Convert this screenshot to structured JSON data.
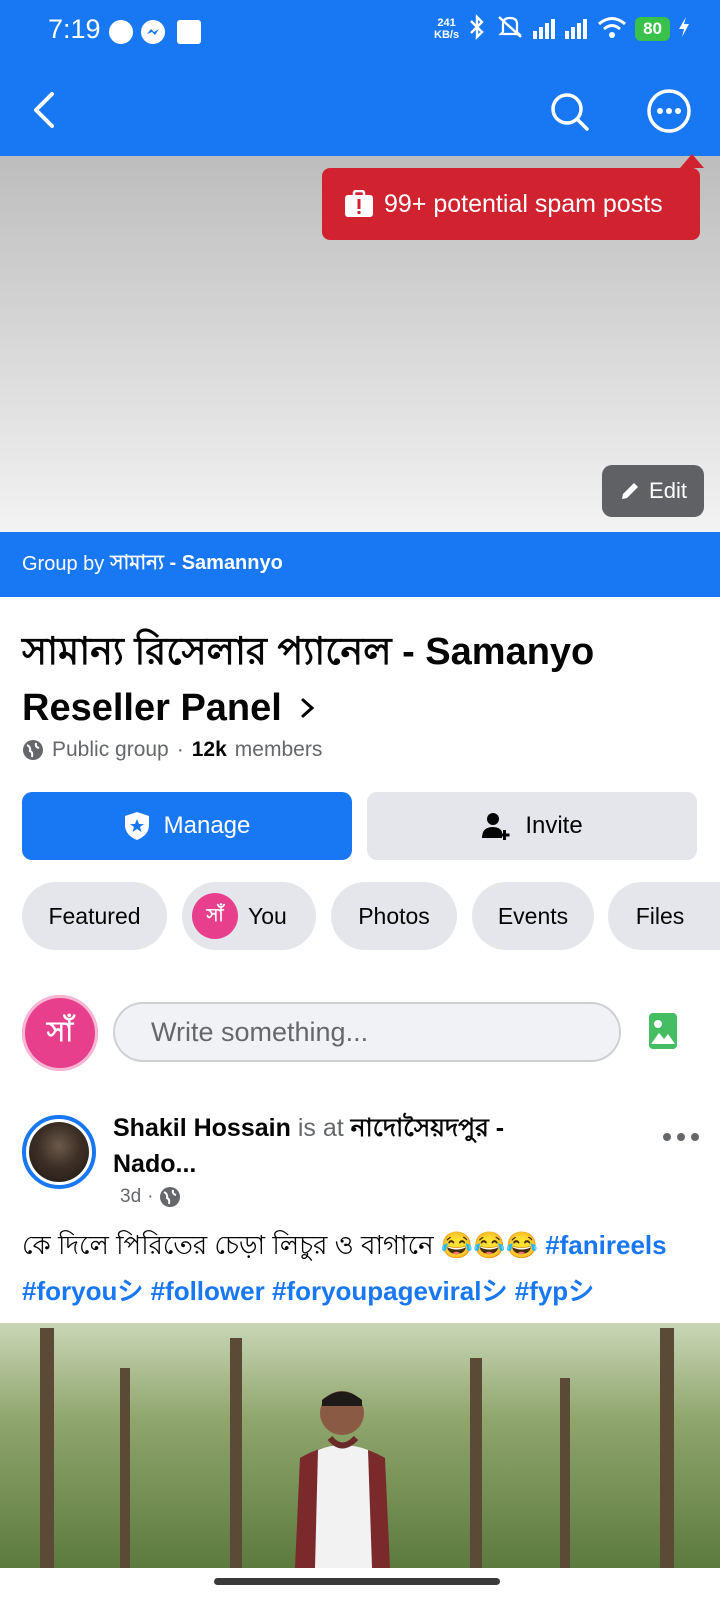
{
  "status_bar": {
    "time": "7:19",
    "net_speed_value": "241",
    "net_speed_unit": "KB/s",
    "battery": "80"
  },
  "colors": {
    "brand": "#1877f2",
    "spam": "#d0232f",
    "chip": "#e4e6eb"
  },
  "icons": [
    "back-arrow-icon",
    "search-icon",
    "more-icon",
    "spam-alert-icon",
    "pencil-icon",
    "globe-icon",
    "shield-star-icon",
    "add-person-icon",
    "photo-icon"
  ],
  "cover": {
    "spam_notice": "99+ potential spam posts",
    "edit_label": "Edit",
    "group_by_prefix": "Group by",
    "group_by_name": "সামান্য - Samannyo"
  },
  "group": {
    "name": "সামান্য রিসেলার প্যানেল - Samanyo Reseller Panel",
    "privacy": "Public group",
    "separator": "·",
    "member_count": "12k",
    "member_label": "members"
  },
  "actions": {
    "manage_label": "Manage",
    "invite_label": "Invite"
  },
  "tabs": [
    {
      "label": "Featured"
    },
    {
      "label": "You"
    },
    {
      "label": "Photos"
    },
    {
      "label": "Events"
    },
    {
      "label": "Files"
    }
  ],
  "composer": {
    "avatar_text": "সাঁ",
    "placeholder": "Write something..."
  },
  "post": {
    "author": "Shakil Hossain",
    "is_at": "is at",
    "location": "নাদোসৈয়দপুর - Nado...",
    "time": "3d",
    "dot": "·",
    "text": "কে দিলে পিরিতের চেড়া লিচুর ও বাগানে 😂😂😂",
    "hashtags": [
      "#fanireels",
      "#foryouシ",
      "#follower",
      "#foryoupageviralシ",
      "#fypシ"
    ]
  }
}
